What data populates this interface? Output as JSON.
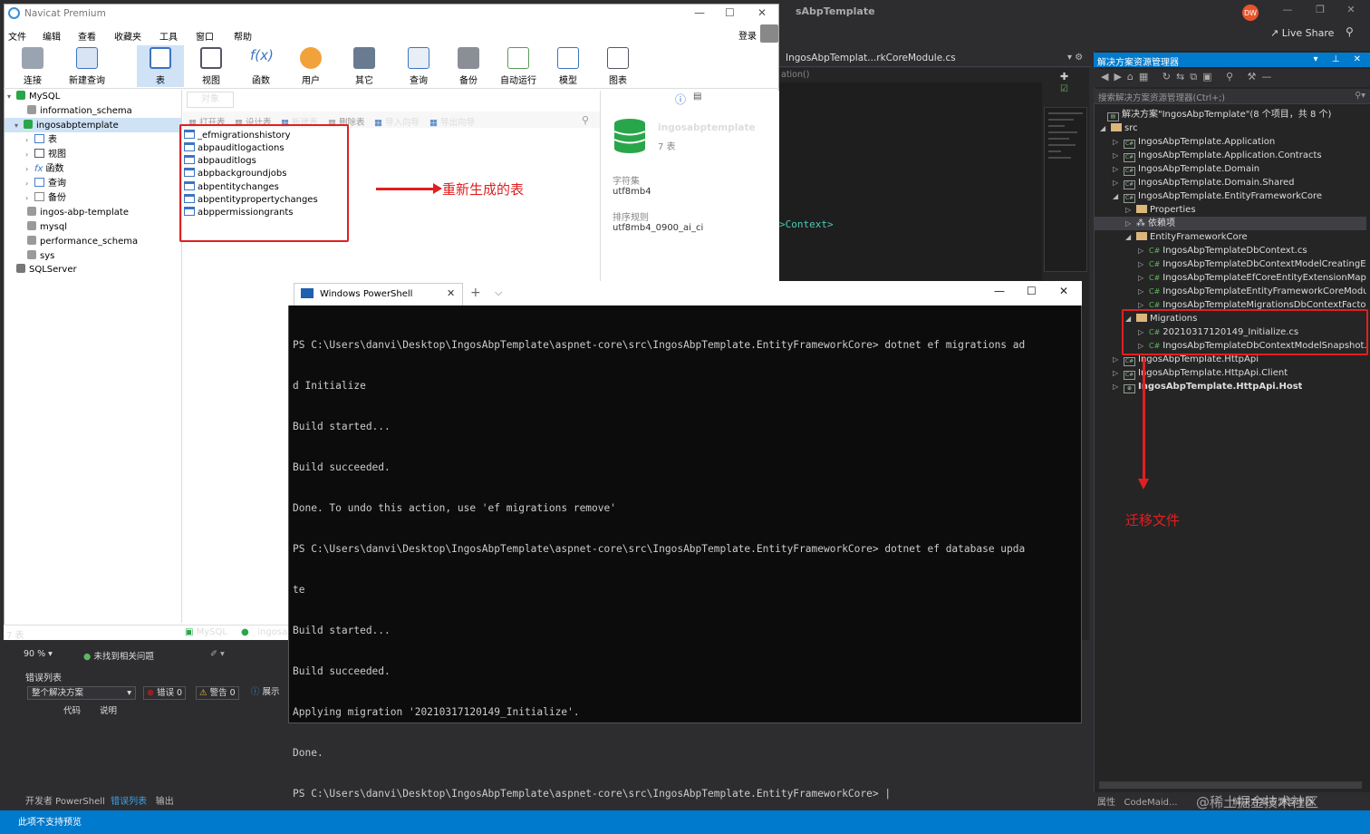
{
  "vs": {
    "title": "sAbpTemplate",
    "avatar": "DW",
    "liveshare": "Live Share",
    "tab_name": "IngosAbpTemplat...rkCoreModule.cs",
    "navbar_text": "ation()",
    "code_text": ">Context>",
    "zoom": "90 %",
    "no_issues": "未找到相关问题",
    "error_list_title": "错误列表",
    "error_scope": "整个解决方案",
    "errors": "错误 0",
    "warnings": "警告 0",
    "messages": "展示",
    "col_code": "代码",
    "col_desc": "说明",
    "bottom_tabs": [
      "开发者 PowerShell",
      "错误列表",
      "输出"
    ],
    "status_text": "此项不支持预览",
    "sol_bottom_tabs": [
      "属性",
      "CodeMaid...",
      "解决方案资源管理器"
    ]
  },
  "solution": {
    "title": "解决方案资源管理器",
    "search_placeholder": "搜索解决方案资源管理器(Ctrl+;)",
    "root": "解决方案\"IngosAbpTemplate\"(8 个项目，共 8 个)",
    "src": "src",
    "items": [
      "IngosAbpTemplate.Application",
      "IngosAbpTemplate.Application.Contracts",
      "IngosAbpTemplate.Domain",
      "IngosAbpTemplate.Domain.Shared",
      "IngosAbpTemplate.EntityFrameworkCore"
    ],
    "properties": "Properties",
    "dependencies": "依赖项",
    "efcore_folder": "EntityFrameworkCore",
    "efcore_files": [
      "IngosAbpTemplateDbContext.cs",
      "IngosAbpTemplateDbContextModelCreatingEx",
      "IngosAbpTemplateEfCoreEntityExtensionMapp",
      "IngosAbpTemplateEntityFrameworkCoreModul",
      "IngosAbpTemplateMigrationsDbContextFactor"
    ],
    "migrations_folder": "Migrations",
    "migration_files": [
      "20210317120149_Initialize.cs",
      "IngosAbpTemplateDbContextModelSnapshot.c"
    ],
    "more_items": [
      "IngosAbpTemplate.HttpApi",
      "IngosAbpTemplate.HttpApi.Client",
      "IngosAbpTemplate.HttpApi.Host"
    ]
  },
  "navicat": {
    "title": "Navicat Premium",
    "menu": [
      "文件",
      "编辑",
      "查看",
      "收藏夹",
      "工具",
      "窗口",
      "帮助"
    ],
    "login": "登录",
    "toolbar": [
      "连接",
      "新建查询",
      "表",
      "视图",
      "函数",
      "用户",
      "其它",
      "查询",
      "备份",
      "自动运行",
      "模型",
      "图表"
    ],
    "tree": {
      "mysql": "MySQL",
      "information_schema": "information_schema",
      "selected_db": "ingosabptemplate",
      "children": [
        "表",
        "视图",
        "函数",
        "查询",
        "备份"
      ],
      "others": [
        "ingos-abp-template",
        "mysql",
        "performance_schema",
        "sys"
      ],
      "sqlserver": "SQLServer"
    },
    "object_tab": "对象",
    "object_bar": [
      "打开表",
      "设计表",
      "新建表",
      "删除表",
      "导入向导",
      "导出向导"
    ],
    "tables": [
      "_efmigrationshistory",
      "abpauditlogactions",
      "abpauditlogs",
      "abpbackgroundjobs",
      "abpentitychanges",
      "abpentitypropertychanges",
      "abppermissiongrants"
    ],
    "annotation": "重新生成的表",
    "info": {
      "db_name": "ingosabptemplate",
      "table_count": "7 表",
      "charset_label": "字符集",
      "charset": "utf8mb4",
      "collation_label": "排序规则",
      "collation": "utf8mb4_0900_ai_ci"
    },
    "status": {
      "count": "7 表",
      "conn": "MySQL",
      "db": "ingosa"
    }
  },
  "powershell": {
    "tab_title": "Windows PowerShell",
    "lines": [
      {
        "type": "cmd",
        "text": "PS C:\\Users\\danvi\\Desktop\\IngosAbpTemplate\\aspnet-core\\src\\IngosAbpTemplate.EntityFrameworkCore> dotnet ef migrations ad"
      },
      {
        "type": "out",
        "text": "d Initialize"
      },
      {
        "type": "out",
        "text": "Build started..."
      },
      {
        "type": "out",
        "text": "Build succeeded."
      },
      {
        "type": "out",
        "text": "Done. To undo this action, use 'ef migrations remove'"
      },
      {
        "type": "cmd",
        "text": "PS C:\\Users\\danvi\\Desktop\\IngosAbpTemplate\\aspnet-core\\src\\IngosAbpTemplate.EntityFrameworkCore> dotnet ef database upda"
      },
      {
        "type": "out",
        "text": "te"
      },
      {
        "type": "out",
        "text": "Build started..."
      },
      {
        "type": "out",
        "text": "Build succeeded."
      },
      {
        "type": "out",
        "text": "Applying migration '20210317120149_Initialize'."
      },
      {
        "type": "out",
        "text": "Done."
      },
      {
        "type": "cmd",
        "text": "PS C:\\Users\\danvi\\Desktop\\IngosAbpTemplate\\aspnet-core\\src\\IngosAbpTemplate.EntityFrameworkCore> |"
      }
    ]
  },
  "annotation_right": "迁移文件",
  "watermark": "@稀土掘金技术社区"
}
